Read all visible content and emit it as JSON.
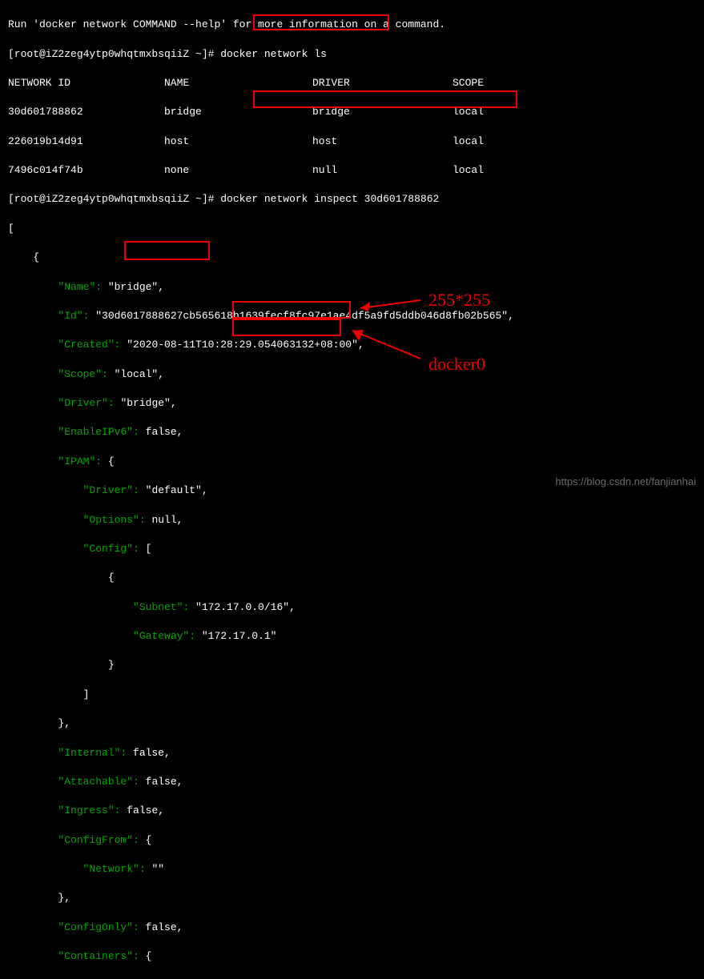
{
  "header_line": "Run 'docker network COMMAND --help' for more information on a command.",
  "prompt1": "[root@iZ2zeg4ytp0whqtmxbsqiiZ ~]#",
  "cmd1": " docker network ls",
  "table": {
    "headers": {
      "id": "NETWORK ID",
      "name": "NAME",
      "driver": "DRIVER",
      "scope": "SCOPE"
    },
    "rows": [
      {
        "id": "30d601788862",
        "name": "bridge",
        "driver": "bridge",
        "scope": "local"
      },
      {
        "id": "226019b14d91",
        "name": "host",
        "driver": "host",
        "scope": "local"
      },
      {
        "id": "7496c014f74b",
        "name": "none",
        "driver": "null",
        "scope": "local"
      }
    ]
  },
  "prompt2": "[root@iZ2zeg4ytp0whqtmxbsqiiZ ~]#",
  "cmd2": " docker network inspect 30d601788862",
  "json_out": {
    "l0": "[",
    "l1": "    {",
    "name_k": "        \"Name\": ",
    "name_v": "\"bridge\",",
    "id_k": "        \"Id\": ",
    "id_v": "\"30d6017888627cb565618b1639fecf8fc97e1ae4df5a9fd5ddb046d8fb02b565\",",
    "created_k": "        \"Created\": ",
    "created_v": "\"2020-08-11T10:28:29.054063132+08:00\",",
    "scope_k": "        \"Scope\": ",
    "scope_v": "\"local\",",
    "driver_k": "        \"Driver\": ",
    "driver_v": "\"bridge\",",
    "ipv6_k": "        \"EnableIPv6\": ",
    "ipv6_v": "false,",
    "ipam_k": "        \"IPAM\": ",
    "ipam_v": "{",
    "ipam_driver_k": "            \"Driver\": ",
    "ipam_driver_v": "\"default\",",
    "ipam_opt_k": "            \"Options\": ",
    "ipam_opt_v": "null,",
    "ipam_cfg_k": "            \"Config\": ",
    "ipam_cfg_v": "[",
    "cfg_open": "                {",
    "subnet_k": "                    \"Subnet\": ",
    "subnet_v": "\"172.17.0.0/16\",",
    "gateway_k": "                    \"Gateway\": ",
    "gateway_v": "\"172.17.0.1\"",
    "cfg_close": "                }",
    "cfg_arr_close": "            ]",
    "ipam_close": "        },",
    "internal_k": "        \"Internal\": ",
    "internal_v": "false,",
    "attach_k": "        \"Attachable\": ",
    "attach_v": "false,",
    "ingress_k": "        \"Ingress\": ",
    "ingress_v": "false,",
    "cfgfrom_k": "        \"ConfigFrom\": ",
    "cfgfrom_v": "{",
    "network_k": "            \"Network\": ",
    "network_v": "\"\"",
    "cfgfrom_close": "        },",
    "cfgonly_k": "        \"ConfigOnly\": ",
    "cfgonly_v": "false,",
    "containers_k": "        \"Containers\": ",
    "containers_v": "{"
  },
  "annotations": {
    "subnet_note": "255*255",
    "gateway_note": "docker0"
  },
  "watermark": "https://blog.csdn.net/fanjianhai"
}
